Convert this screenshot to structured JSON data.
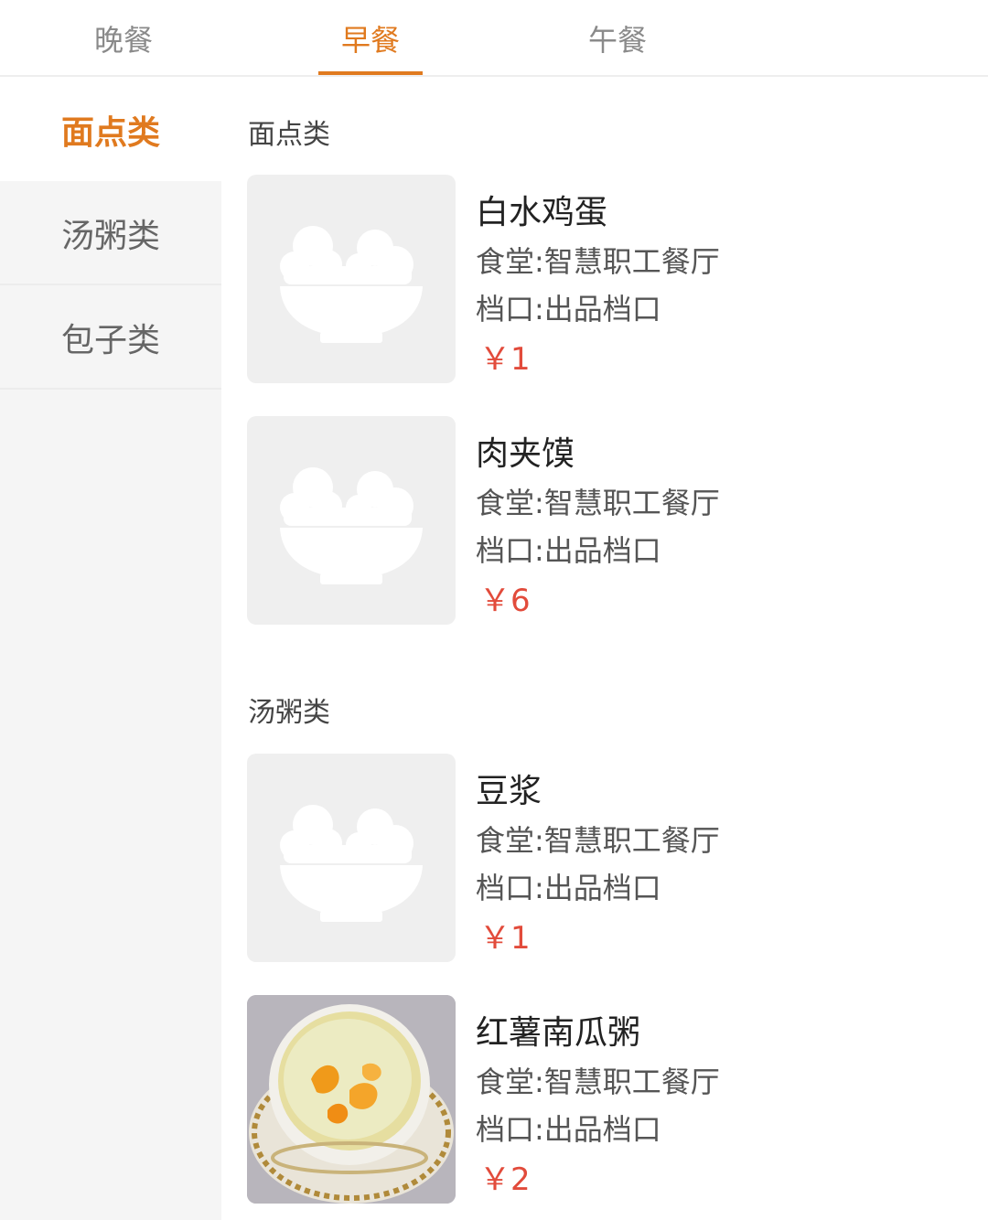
{
  "tabs": [
    {
      "label": "晚餐"
    },
    {
      "label": "早餐"
    },
    {
      "label": "午餐"
    }
  ],
  "active_tab": "早餐",
  "sidebar": {
    "items": [
      {
        "label": "面点类"
      },
      {
        "label": "汤粥类"
      },
      {
        "label": "包子类"
      }
    ],
    "active": "面点类"
  },
  "sections": [
    {
      "title": "面点类",
      "items": [
        {
          "name": "白水鸡蛋",
          "canteen": "食堂:智慧职工餐厅",
          "stall": "档口:出品档口",
          "price": "￥1",
          "image": "bowl-placeholder-icon"
        },
        {
          "name": "肉夹馍",
          "canteen": "食堂:智慧职工餐厅",
          "stall": "档口:出品档口",
          "price": "￥6",
          "image": "bowl-placeholder-icon"
        }
      ]
    },
    {
      "title": "汤粥类",
      "items": [
        {
          "name": "豆浆",
          "canteen": "食堂:智慧职工餐厅",
          "stall": "档口:出品档口",
          "price": "￥1",
          "image": "bowl-placeholder-icon"
        },
        {
          "name": "红薯南瓜粥",
          "canteen": "食堂:智慧职工餐厅",
          "stall": "档口:出品档口",
          "price": "￥2",
          "image": "porridge-photo"
        }
      ]
    }
  ],
  "colors": {
    "accent": "#e07a1f",
    "price": "#e24b3b",
    "sidebar_bg": "#f5f5f5",
    "placeholder_bg": "#efefef"
  }
}
